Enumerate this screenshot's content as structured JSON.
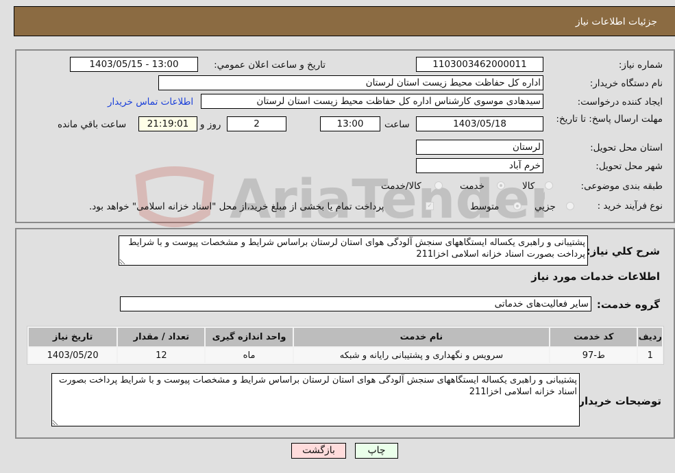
{
  "header": {
    "title": "جزئیات اطلاعات نیاز"
  },
  "form": {
    "need_number_label": "شماره نیاز:",
    "need_number": "1103003462000011",
    "announce_label": "تاریخ و ساعت اعلان عمومي:",
    "announce_value": "1403/05/15 - 13:00",
    "buyer_org_label": "نام دستگاه خریدار:",
    "buyer_org": "اداره کل حفاظت محیط زیست استان لرستان",
    "creator_label": "ایجاد کننده درخواست:",
    "creator": "سیدهادی موسوی کارشناس اداره کل حفاظت محیط زیست استان لرستان",
    "contact_link": "اطلاعات تماس خریدار",
    "deadline_label": "مهلت ارسال پاسخ: تا تاریخ:",
    "deadline_date": "1403/05/18",
    "time_label": "ساعت",
    "deadline_time": "13:00",
    "days_value": "2",
    "days_label": "روز و",
    "remaining_time": "21:19:01",
    "remaining_label": "ساعت باقي مانده",
    "province_label": "استان محل تحویل:",
    "province": "لرستان",
    "city_label": "شهر محل تحویل:",
    "city": "خرم آباد",
    "category_label": "طبقه بندی موضوعی:",
    "category_options": [
      {
        "label": "کالا",
        "checked": false
      },
      {
        "label": "خدمت",
        "checked": true
      },
      {
        "label": "کالا/خدمت",
        "checked": false
      }
    ],
    "process_label": "نوع فرآیند خرید :",
    "process_options": [
      {
        "label": "جزيي",
        "checked": false
      },
      {
        "label": "متوسط",
        "checked": true
      }
    ],
    "treasury_checkbox_checked": true,
    "treasury_text": "پرداخت تمام یا بخشی از مبلغ خرید،از محل \"اسناد خزانه اسلامی\" خواهد بود."
  },
  "details": {
    "general_desc_label": "شرح کلي نیاز:",
    "general_desc": "پشتیبانی و راهبری یکساله ایستگاههای سنجش آلودگی هوای استان لرستان براساس شرایط و مشخصات پیوست و با شرایط پرداخت بصورت اسناد خزانه اسلامی اخزا211",
    "services_title": "اطلاعات خدمات مورد نیاز",
    "service_group_label": "گروه خدمت:",
    "service_group": "سایر فعالیت‌های خدماتی",
    "table": {
      "headers": [
        "ردیف",
        "کد خدمت",
        "نام خدمت",
        "واحد اندازه گیری",
        "تعداد / مقدار",
        "تاریخ نیاز"
      ],
      "rows": [
        [
          "1",
          "ط-97",
          "سرویس و نگهداری و پشتیبانی رایانه و شبکه",
          "ماه",
          "12",
          "1403/05/20"
        ]
      ]
    },
    "buyer_notes_label": "توضیحات خریدار:",
    "buyer_notes": "پشتیبانی و راهبری یکساله ایستگاههای سنجش آلودگی هوای استان لرستان براساس شرایط و مشخصات پیوست و با شرایط پرداخت بصورت اسناد خزانه اسلامی اخزا211"
  },
  "buttons": {
    "print": "چاپ",
    "back": "بازگشت"
  },
  "watermark": {
    "text": "AriaTender.net"
  },
  "colors": {
    "header_bg": "#8b6b42",
    "print_bg": "#eaffea",
    "back_bg": "#ffdcdc",
    "link": "#1a3fd9"
  }
}
